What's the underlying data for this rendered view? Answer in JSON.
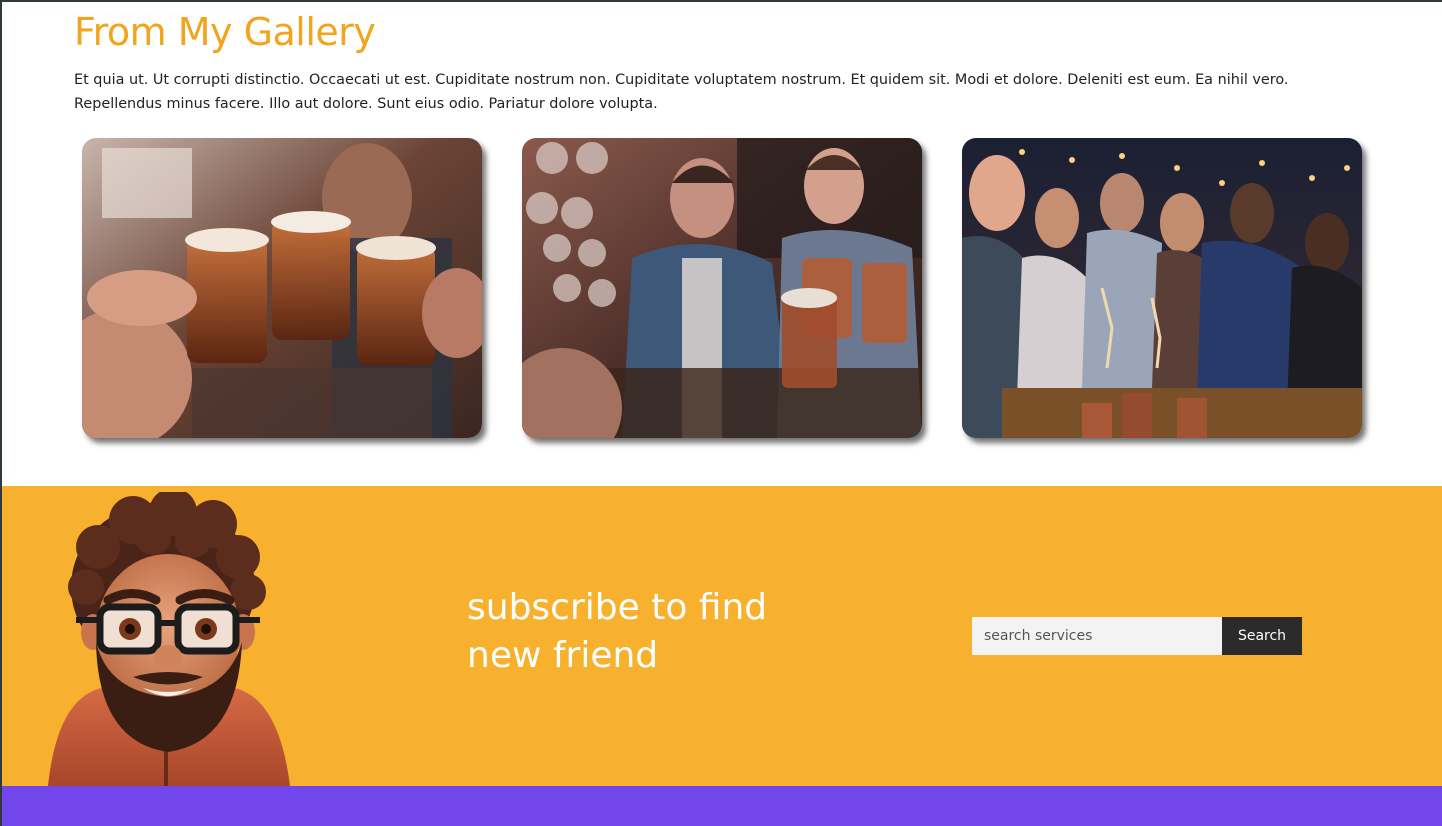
{
  "gallery": {
    "title": "From My Gallery",
    "description": "Et quia ut. Ut corrupti distinctio. Occaecati ut est. Cupiditate nostrum non. Cupiditate voluptatem nostrum. Et quidem sit. Modi et dolore. Deleniti est eum. Ea nihil vero. Repellendus minus facere. Illo aut dolore. Sunt eius odio. Pariatur dolore volupta.",
    "photos": [
      {
        "subject": "friends-toasting-beer-mugs"
      },
      {
        "subject": "two-men-cheering-in-bar"
      },
      {
        "subject": "group-toasting-cocktails-night"
      }
    ]
  },
  "subscribe": {
    "heading_line1": "subscribe to find",
    "heading_line2": "new friend",
    "search_placeholder": "search services",
    "search_button_label": "Search",
    "avatar": "bearded-man-3d-avatar"
  },
  "colors": {
    "accent_orange": "#f3a41f",
    "subscribe_bg": "#f7b12e",
    "button_dark": "#2b2b2b",
    "footer_purple": "#7246ea"
  }
}
